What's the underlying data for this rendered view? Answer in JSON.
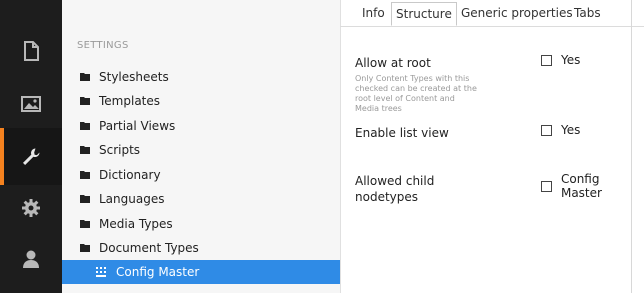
{
  "rail": {
    "items": [
      {
        "icon": "document-icon"
      },
      {
        "icon": "image-icon"
      },
      {
        "icon": "wrench-icon",
        "active": true
      },
      {
        "icon": "gear-icon"
      },
      {
        "icon": "user-icon"
      }
    ],
    "accent": "#f5821f"
  },
  "tree": {
    "header": "SETTINGS",
    "items": [
      {
        "label": "Stylesheets"
      },
      {
        "label": "Templates"
      },
      {
        "label": "Partial Views"
      },
      {
        "label": "Scripts"
      },
      {
        "label": "Dictionary"
      },
      {
        "label": "Languages"
      },
      {
        "label": "Media Types"
      },
      {
        "label": "Document Types"
      },
      {
        "label": "Config Master",
        "selected": true
      }
    ],
    "selected_color": "#2f8be6"
  },
  "tabs": [
    {
      "label": "Info"
    },
    {
      "label": "Structure",
      "active": true
    },
    {
      "label": "Generic properties"
    },
    {
      "label": "Tabs"
    }
  ],
  "properties": {
    "allow_root": {
      "label": "Allow at root",
      "description": "Only Content Types with this checked can be created at the root level of Content and Media trees",
      "option": "Yes"
    },
    "list_view": {
      "label": "Enable list view",
      "option": "Yes"
    },
    "child_nodetypes": {
      "label": "Allowed child nodetypes",
      "option": "Config Master"
    }
  }
}
